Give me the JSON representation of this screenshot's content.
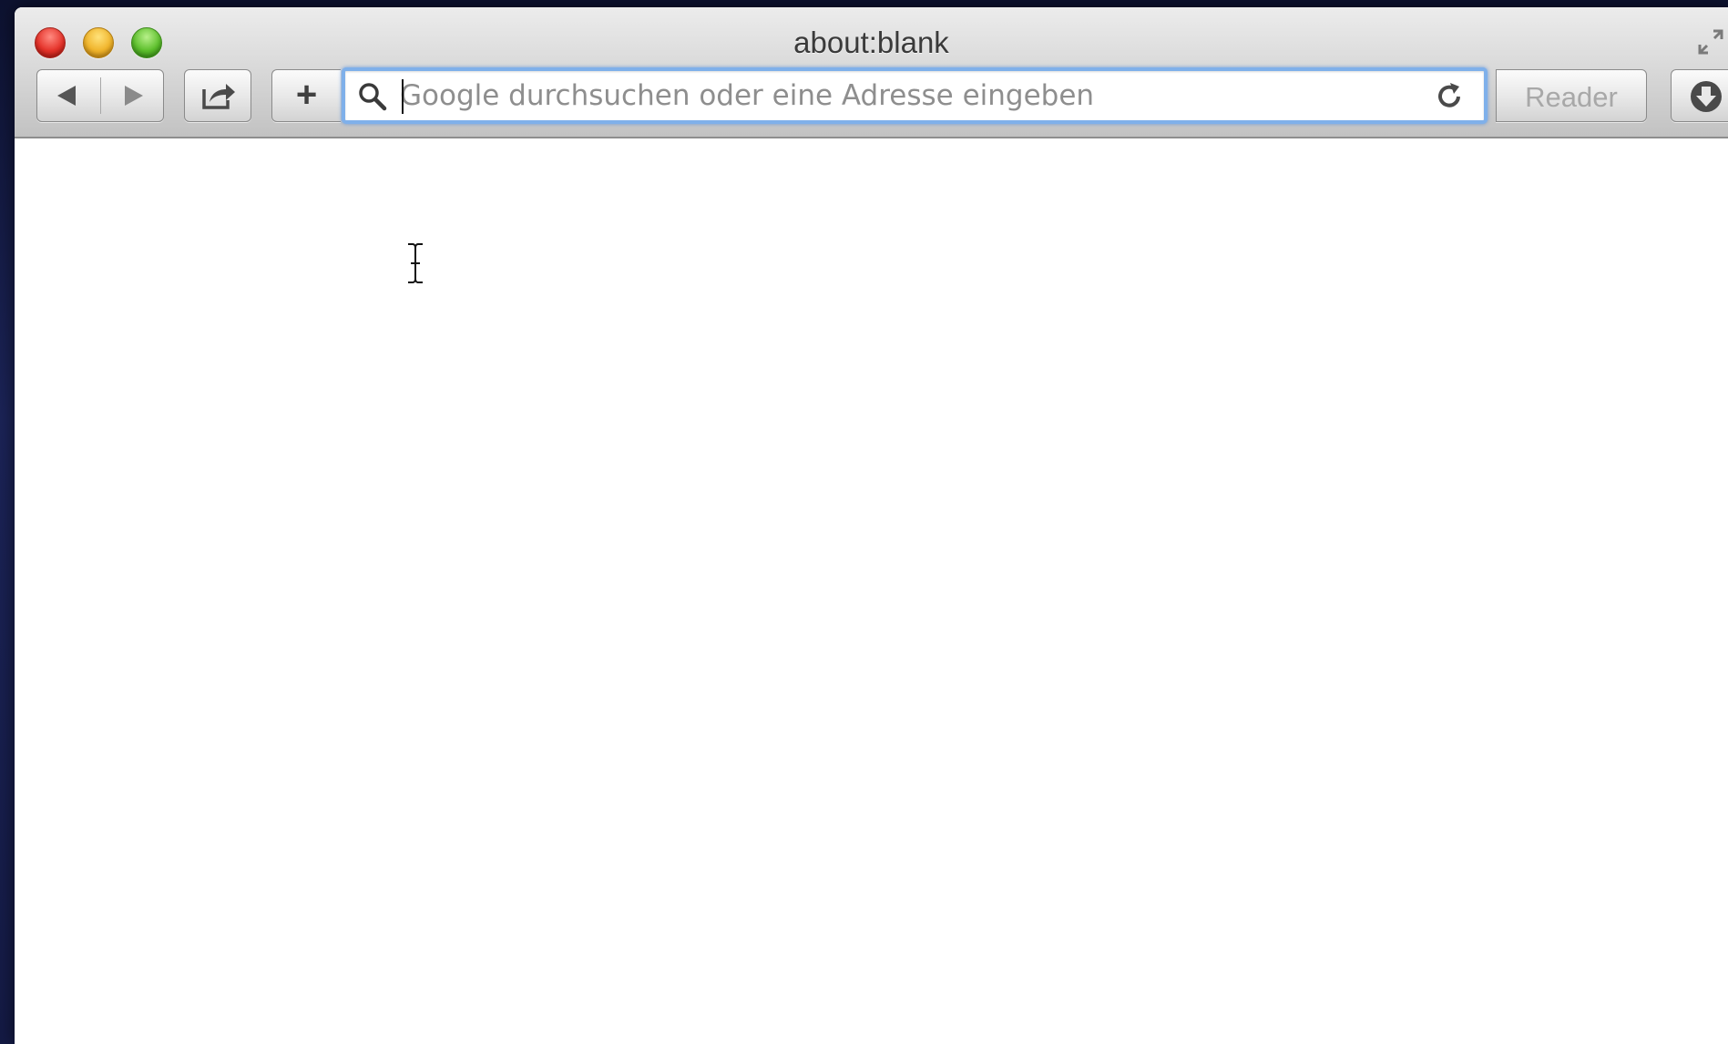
{
  "window": {
    "title": "about:blank"
  },
  "toolbar": {
    "back_icon": "chevron-left-icon",
    "forward_icon": "chevron-right-icon",
    "share_icon": "share-icon",
    "add_label": "+",
    "reader_label": "Reader",
    "downloads_icon": "download-icon"
  },
  "address_bar": {
    "placeholder": "Google durchsuchen oder eine Adresse eingeben",
    "value": "",
    "search_icon": "magnifier-icon",
    "reload_icon": "reload-icon"
  },
  "colors": {
    "close": "#e5332a",
    "minimize": "#f0b42b",
    "zoom": "#5dbf2c",
    "focus_ring": "#7fb0ea"
  }
}
